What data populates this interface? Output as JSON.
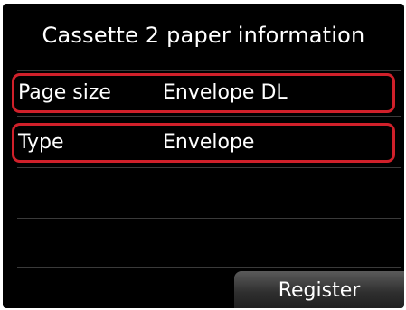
{
  "screen": {
    "title": "Cassette 2 paper information"
  },
  "settings": {
    "page_size": {
      "label": "Page size",
      "value": "Envelope DL"
    },
    "type": {
      "label": "Type",
      "value": "Envelope"
    }
  },
  "actions": {
    "register_label": "Register"
  },
  "colors": {
    "highlight": "#d0202a",
    "background": "#000000",
    "text": "#ffffff"
  }
}
